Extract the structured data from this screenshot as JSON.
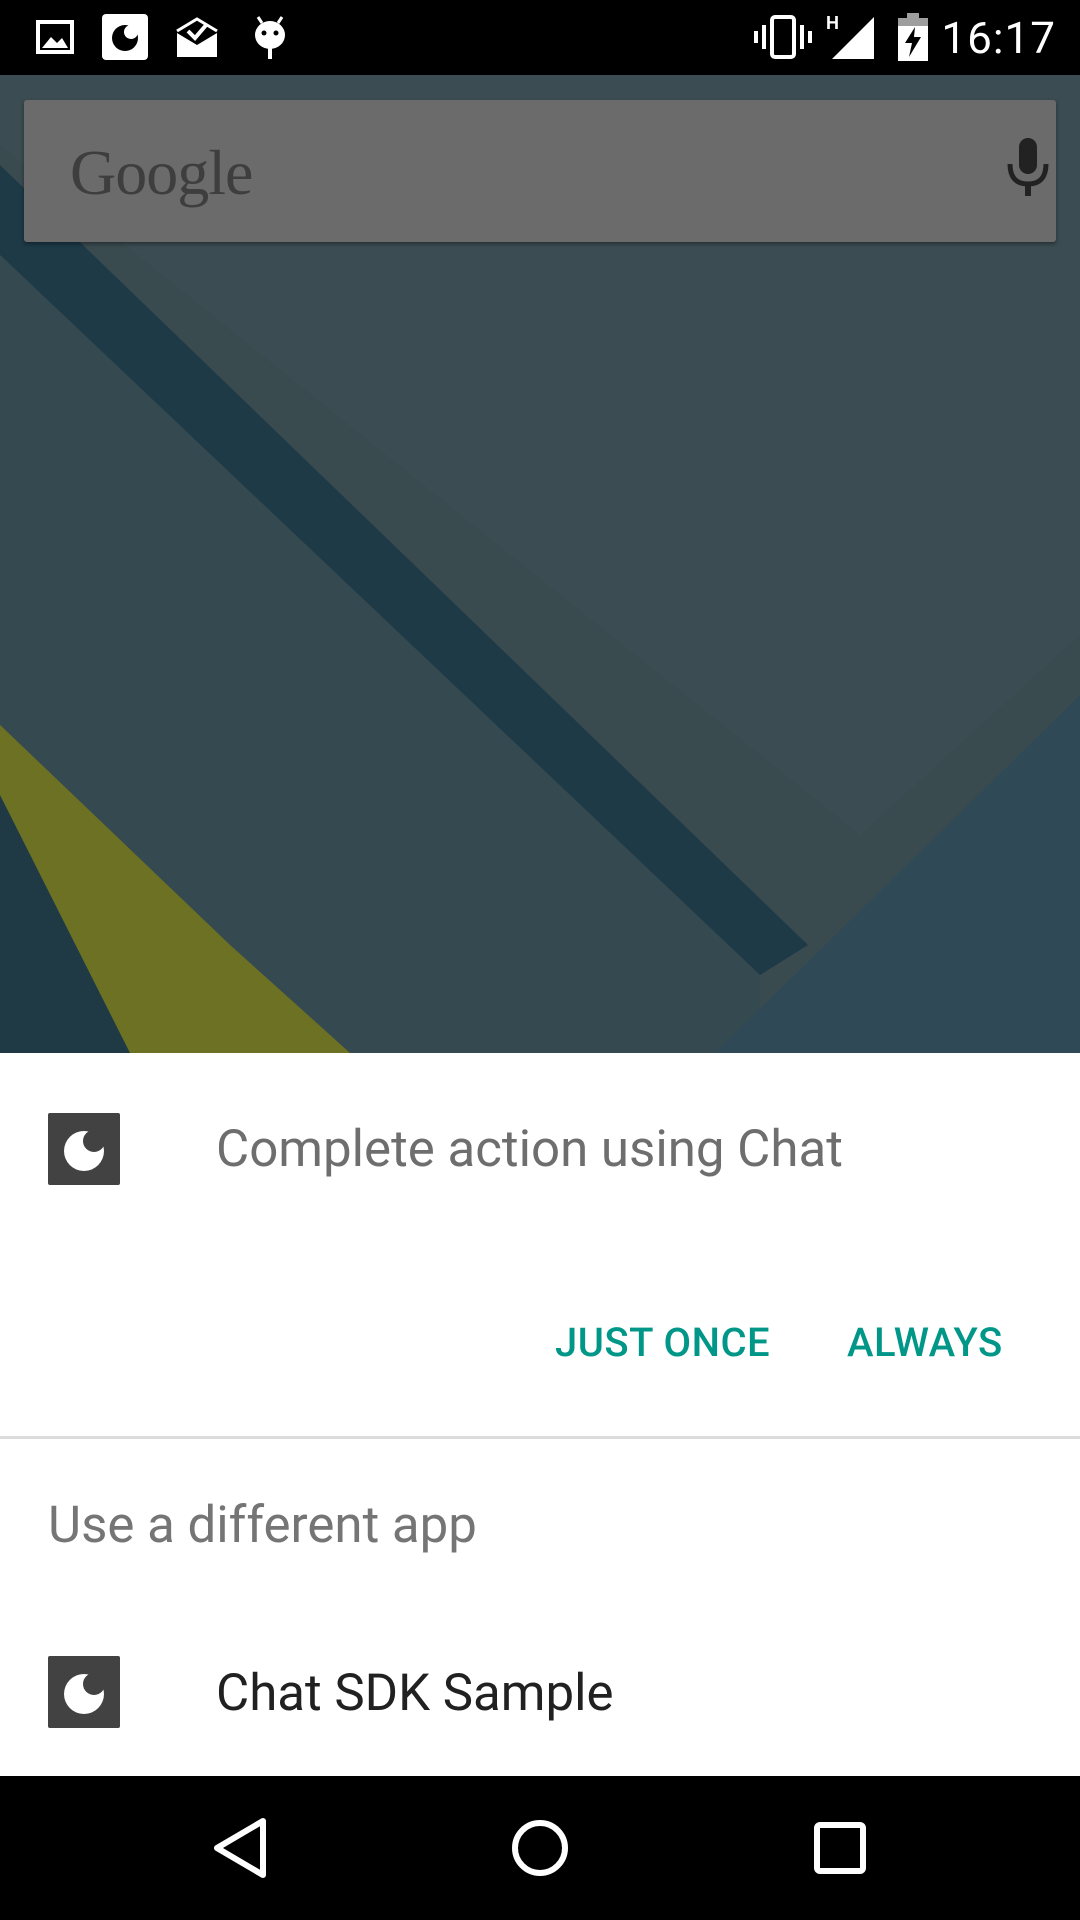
{
  "status_bar": {
    "time": "16:17",
    "network_label": "H",
    "left_icons": [
      "image-icon",
      "chat-app-icon",
      "mail-check-icon",
      "android-debug-icon"
    ],
    "right_icons": [
      "vibrate-icon",
      "signal-icon",
      "battery-charging-icon"
    ]
  },
  "home": {
    "search_logo": "Google",
    "search_icon": "mic-icon"
  },
  "dialog": {
    "title": "Complete action using Chat",
    "title_icon": "chat-app-icon",
    "buttons": {
      "just_once": "JUST ONCE",
      "always": "ALWAYS"
    },
    "section_label": "Use a different app",
    "apps": [
      {
        "name": "Chat SDK Sample",
        "icon": "chat-app-icon"
      }
    ]
  },
  "colors": {
    "accent": "#009688",
    "dialog_bg": "#ffffff",
    "icon_bg": "#424242"
  },
  "nav_bar": {
    "buttons": [
      "back-icon",
      "home-icon",
      "recents-icon"
    ]
  }
}
